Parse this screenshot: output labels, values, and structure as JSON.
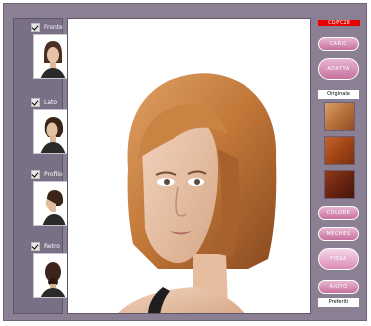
{
  "views": [
    {
      "label": "Fronte"
    },
    {
      "label": "Lato"
    },
    {
      "label": "Profilo"
    },
    {
      "label": "Retro"
    }
  ],
  "panel": {
    "brand": "CD/FC28",
    "buttons": [
      "CARIC",
      "ADATTA",
      "COLORE",
      "MECHES",
      "FISSA",
      "AIUTO"
    ],
    "original_label": "Originale",
    "favorites_label": "Preferiti"
  },
  "colors": {
    "frame": "#8a7f93",
    "button_pink": "#d387b0",
    "brand_red": "#e60000"
  }
}
